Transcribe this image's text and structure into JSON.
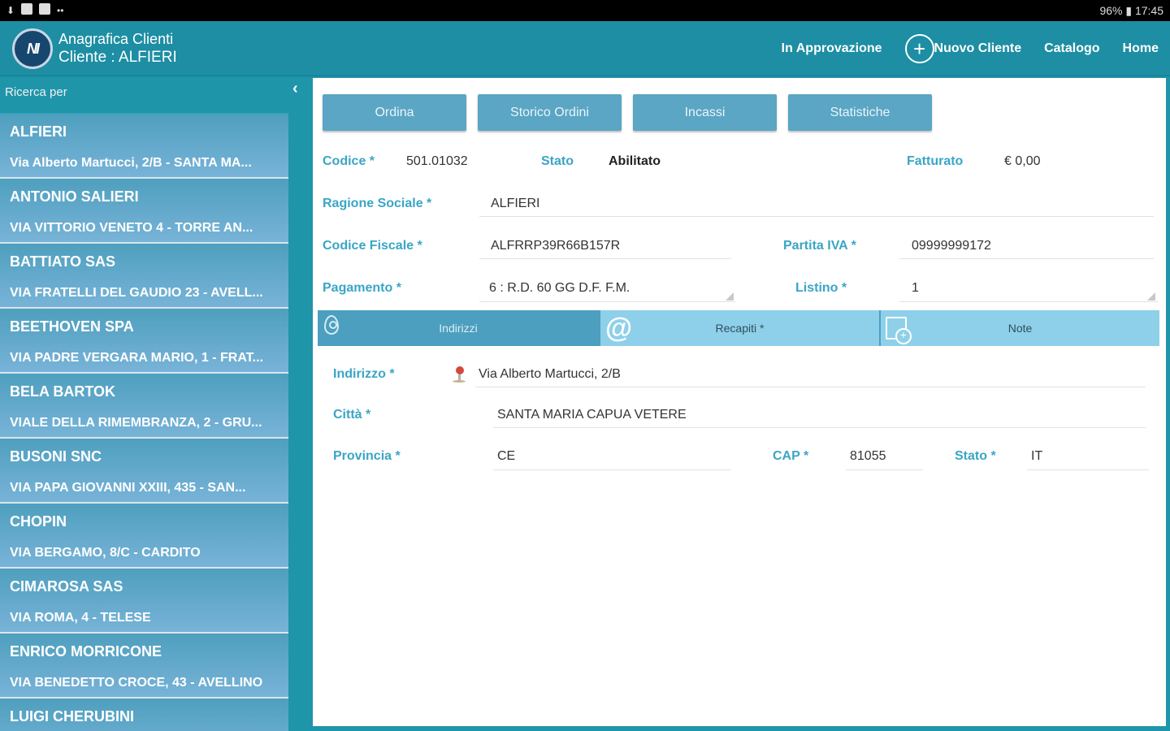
{
  "statusbar": {
    "right": "96% ▮ 17:45"
  },
  "header": {
    "logo_text": "NI",
    "title": "Anagrafica Clienti",
    "subtitle": "Cliente : ALFIERI",
    "nav": {
      "approval": "In Approvazione",
      "new_client": "Nuovo Cliente",
      "catalog": "Catalogo",
      "home": "Home"
    }
  },
  "sidebar": {
    "search_label": "Ricerca per",
    "clients": [
      {
        "name": "ALFIERI",
        "address": "Via Alberto Martucci, 2/B - SANTA MA..."
      },
      {
        "name": "ANTONIO SALIERI",
        "address": "VIA VITTORIO VENETO 4 - TORRE AN..."
      },
      {
        "name": "BATTIATO SAS",
        "address": "VIA FRATELLI DEL GAUDIO 23 - AVELL..."
      },
      {
        "name": "BEETHOVEN SPA",
        "address": "VIA PADRE VERGARA MARIO, 1 - FRAT..."
      },
      {
        "name": "BELA BARTOK",
        "address": "VIALE DELLA RIMEMBRANZA, 2 - GRU..."
      },
      {
        "name": "BUSONI SNC",
        "address": "VIA PAPA GIOVANNI XXIII, 435 - SAN..."
      },
      {
        "name": "CHOPIN",
        "address": "VIA BERGAMO, 8/C - CARDITO"
      },
      {
        "name": "CIMAROSA SAS",
        "address": "VIA ROMA, 4 - TELESE"
      },
      {
        "name": "ENRICO MORRICONE",
        "address": "VIA BENEDETTO CROCE, 43 - AVELLINO"
      },
      {
        "name": "LUIGI CHERUBINI",
        "address": ""
      }
    ]
  },
  "actions": {
    "order": "Ordina",
    "history": "Storico Ordini",
    "payments": "Incassi",
    "stats": "Statistiche"
  },
  "form": {
    "codice_label": "Codice *",
    "codice": "501.01032",
    "stato_label": "Stato",
    "stato": "Abilitato",
    "fatturato_label": "Fatturato",
    "fatturato": "€ 0,00",
    "ragione_label": "Ragione Sociale *",
    "ragione": "ALFIERI",
    "cf_label": "Codice Fiscale *",
    "cf": "ALFRRP39R66B157R",
    "piva_label": "Partita IVA *",
    "piva": "09999999172",
    "pagamento_label": "Pagamento *",
    "pagamento": "6 : R.D. 60 GG D.F. F.M.",
    "listino_label": "Listino *",
    "listino": "1"
  },
  "tabs": {
    "indirizzi": "Indirizzi",
    "recapiti": "Recapiti *",
    "note": "Note"
  },
  "address": {
    "indirizzo_label": "Indirizzo *",
    "indirizzo": "Via Alberto Martucci, 2/B",
    "citta_label": "Città *",
    "citta": "SANTA MARIA CAPUA VETERE",
    "provincia_label": "Provincia *",
    "provincia": "CE",
    "cap_label": "CAP *",
    "cap": "81055",
    "stato_label": "Stato *",
    "stato": "IT"
  }
}
